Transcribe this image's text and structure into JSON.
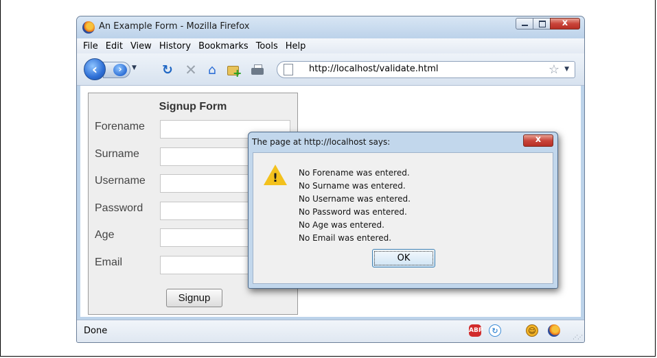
{
  "window": {
    "title": "An Example Form - Mozilla Firefox",
    "close_glyph": "x"
  },
  "menu": [
    "File",
    "Edit",
    "View",
    "History",
    "Bookmarks",
    "Tools",
    "Help"
  ],
  "toolbar": {
    "url": "http://localhost/validate.html",
    "icons": [
      "back-icon",
      "forward-icon",
      "reload-icon",
      "stop-icon",
      "home-icon",
      "bookmark-add-icon",
      "print-icon",
      "page-icon",
      "star-icon"
    ]
  },
  "form": {
    "title": "Signup Form",
    "fields": [
      {
        "label": "Forename",
        "value": ""
      },
      {
        "label": "Surname",
        "value": ""
      },
      {
        "label": "Username",
        "value": ""
      },
      {
        "label": "Password",
        "value": ""
      },
      {
        "label": "Age",
        "value": ""
      },
      {
        "label": "Email",
        "value": ""
      }
    ],
    "submit_label": "Signup"
  },
  "alert": {
    "title": "The page at http://localhost says:",
    "close_glyph": "x",
    "icon": "warning-icon",
    "warning_mark": "!",
    "messages": [
      "No Forename was entered.",
      "No Surname was entered.",
      "No Username was entered.",
      "No Password was entered.",
      "No Age was entered.",
      "No Email was entered."
    ],
    "ok_label": "OK"
  },
  "statusbar": {
    "text": "Done",
    "abp_label": "ABP",
    "icons": [
      "adblock-icon",
      "sync-icon",
      "greasemonkey-icon",
      "firefox-icon"
    ]
  },
  "colors": {
    "chrome": "#bcd3ea",
    "close_red": "#c9453a",
    "warning_yellow": "#f3c11d"
  }
}
